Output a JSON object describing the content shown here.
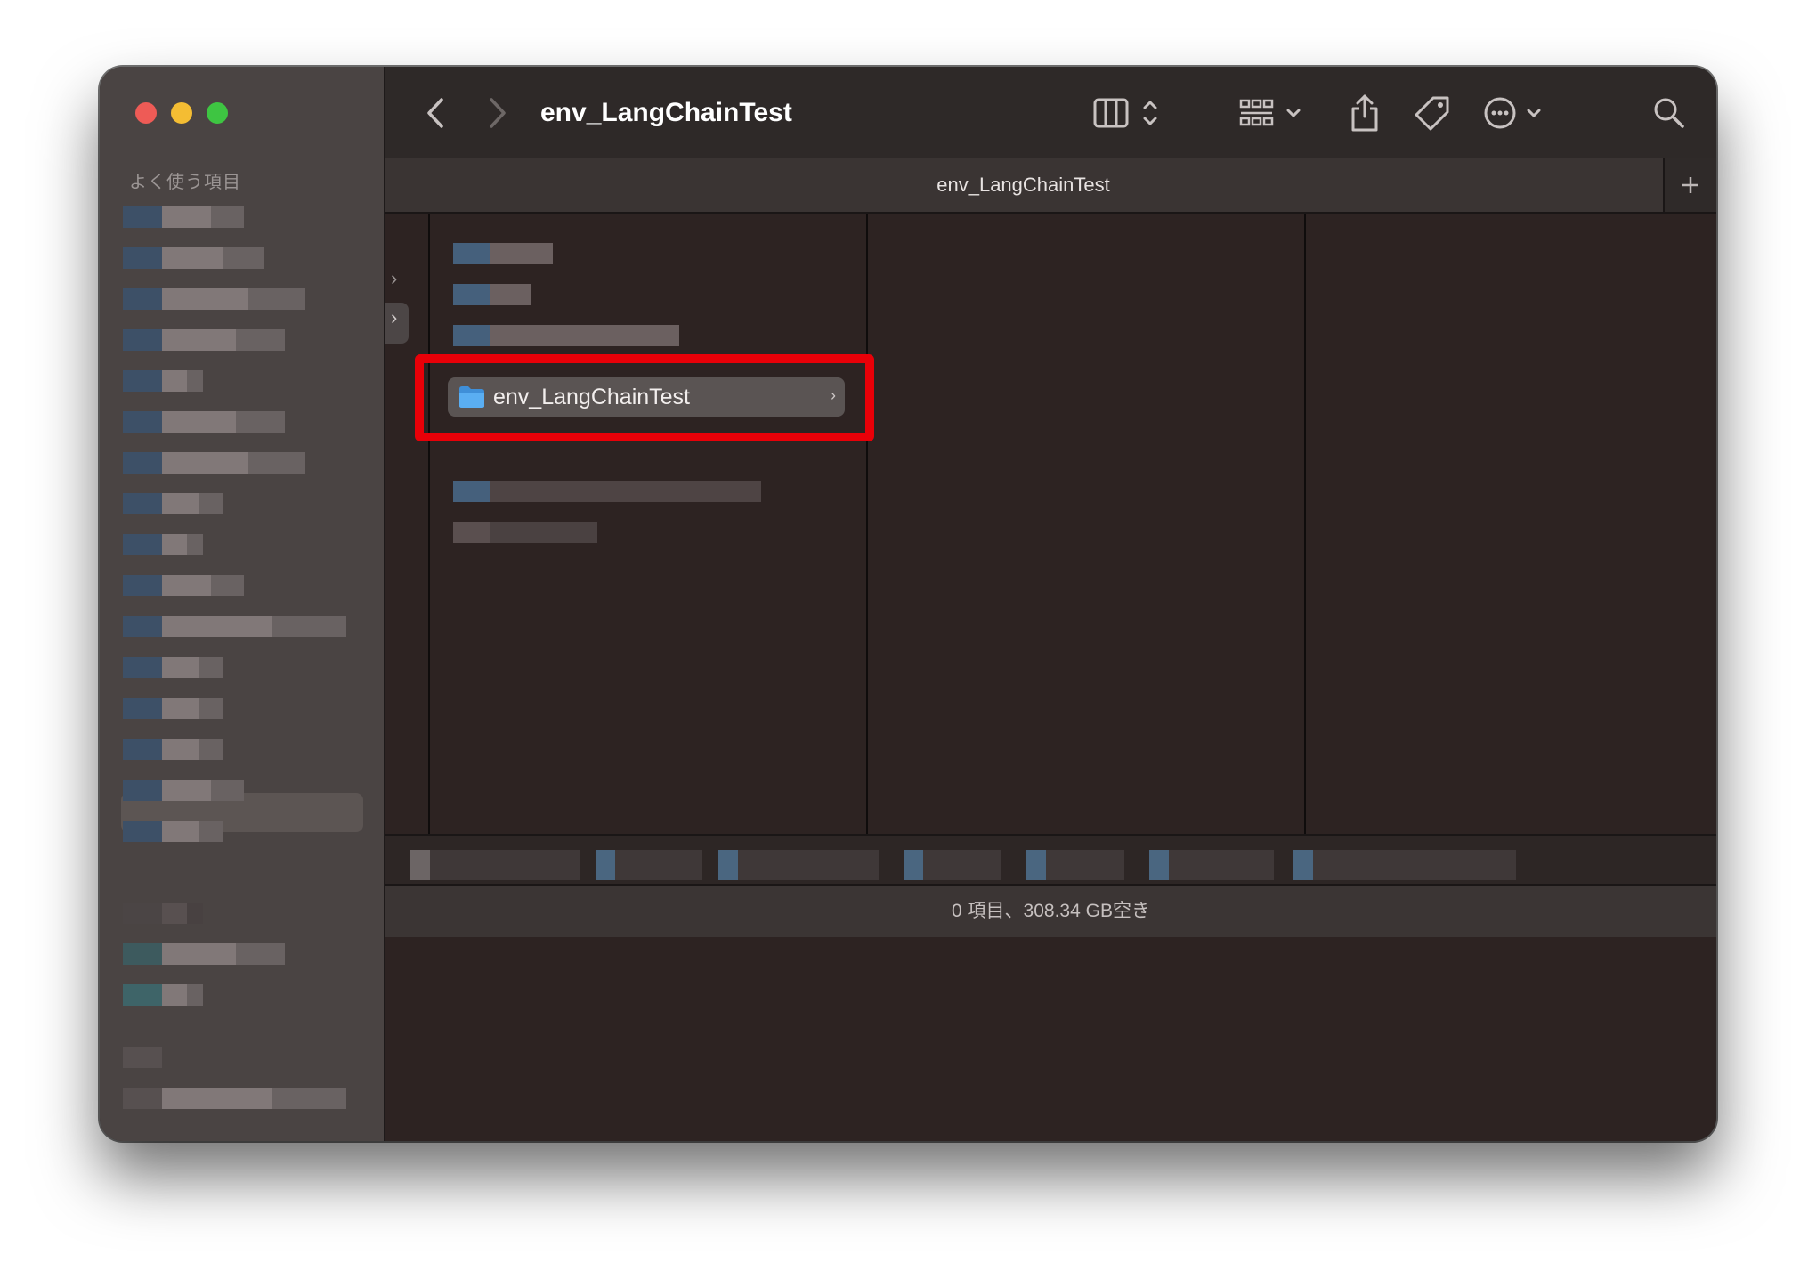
{
  "window": {
    "title": "env_LangChainTest"
  },
  "sidebar": {
    "heading": "よく使う項目"
  },
  "tab": {
    "label": "env_LangChainTest"
  },
  "column1": {
    "selected_folder": "env_LangChainTest"
  },
  "status": {
    "text": "0 項目、308.34 GB空き"
  },
  "colors": {
    "highlight": "#e80008",
    "window_bg": "#2d2322",
    "sidebar_bg": "#4a4443",
    "folder": "#5aaef2"
  }
}
